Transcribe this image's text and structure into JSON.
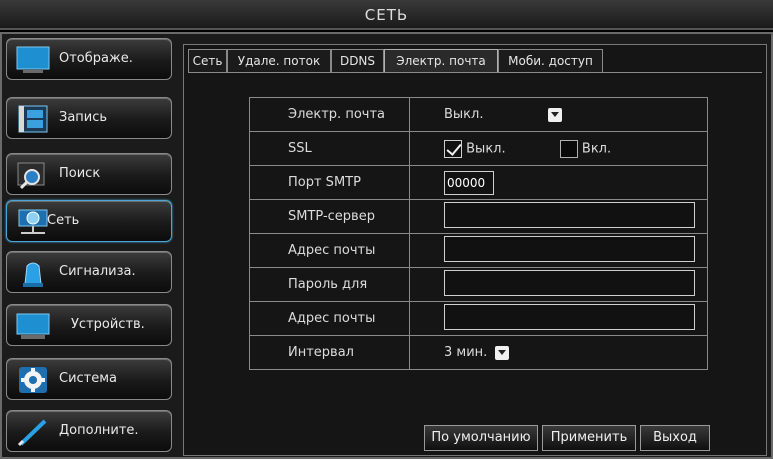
{
  "title": "СЕТЬ",
  "sidebar": {
    "items": [
      {
        "label": "Отображе.",
        "icon": "monitor-icon",
        "active": false
      },
      {
        "label": "Запись",
        "icon": "film-icon",
        "active": false
      },
      {
        "label": "Поиск",
        "icon": "magnifier-icon",
        "active": false
      },
      {
        "label": "Сеть",
        "icon": "network-globe-icon",
        "active": true
      },
      {
        "label": "Сигнализа.",
        "icon": "siren-icon",
        "active": false
      },
      {
        "label": "Устройств.",
        "icon": "device-monitor-icon",
        "active": false
      },
      {
        "label": "Система",
        "icon": "gear-icon",
        "active": false
      },
      {
        "label": "Дополните.",
        "icon": "pen-icon",
        "active": false
      }
    ]
  },
  "tabs": [
    {
      "label": "Сеть",
      "active": false
    },
    {
      "label": "Удале. поток",
      "active": false
    },
    {
      "label": "DDNS",
      "active": false
    },
    {
      "label": "Электр. почта",
      "active": true
    },
    {
      "label": "Моби. доступ",
      "active": false
    }
  ],
  "form": {
    "email_label": "Электр. почта",
    "email_value": "Выкл.",
    "ssl_label": "SSL",
    "ssl_off_label": "Выкл.",
    "ssl_on_label": "Вкл.",
    "ssl_selected": "off",
    "smtp_port_label": "Порт SMTP",
    "smtp_port_value": "00000",
    "smtp_server_label": "SMTP-сервер",
    "smtp_server_value": "",
    "sender_label": "Адрес почты",
    "sender_value": "",
    "password_label": "Пароль для",
    "password_value": "",
    "recipient_label": "Адрес почты",
    "recipient_value": "",
    "interval_label": "Интервал",
    "interval_value": "3 мин."
  },
  "buttons": {
    "default": "По умолчанию",
    "apply": "Применить",
    "exit": "Выход"
  },
  "colors": {
    "accent": "#4aa6d8",
    "icon_blue": "#1e8fd0"
  }
}
